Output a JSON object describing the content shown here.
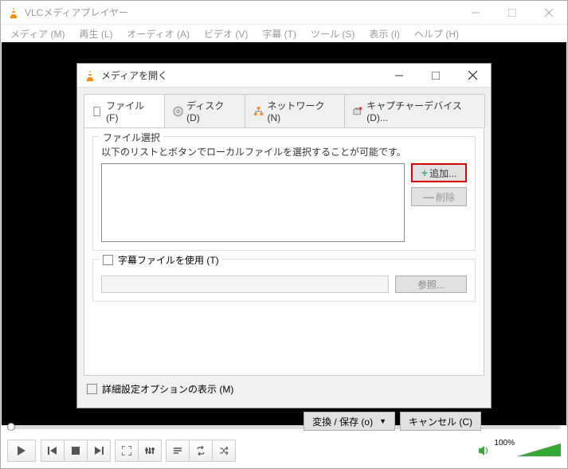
{
  "main": {
    "title": "VLCメディアプレイヤー",
    "menu": [
      "メディア (M)",
      "再生 (L)",
      "オーディオ (A)",
      "ビデオ (V)",
      "字幕 (T)",
      "ツール (S)",
      "表示 (I)",
      "ヘルプ (H)"
    ],
    "volume": "100%"
  },
  "dialog": {
    "title": "メディアを開く",
    "tabs": {
      "file": "ファイル (F)",
      "disc": "ディスク (D)",
      "network": "ネットワーク (N)",
      "capture": "キャプチャーデバイス(D)..."
    },
    "file_section": {
      "legend": "ファイル選択",
      "desc": "以下のリストとボタンでローカルファイルを選択することが可能です。",
      "add": "追加...",
      "remove": "削除"
    },
    "subtitle_section": {
      "checkbox": "字幕ファイルを使用 (T)",
      "browse": "参照..."
    },
    "advanced": "詳細設定オプションの表示 (M)",
    "convert": "変換 / 保存 (o)",
    "cancel": "キャンセル (C)"
  }
}
